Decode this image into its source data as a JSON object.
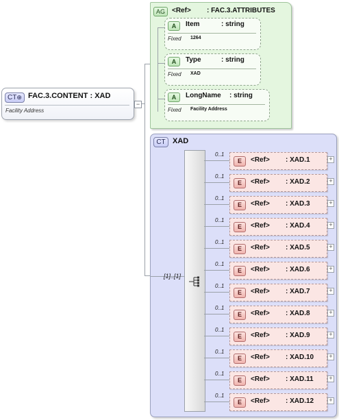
{
  "root": {
    "badge": "CT",
    "name": "FAC.3.CONTENT",
    "type": ": XAD",
    "documentation": "Facility Address"
  },
  "attribute_group": {
    "badge": "AG",
    "ref": "<Ref>",
    "type": ": FAC.3.ATTRIBUTES",
    "attributes": [
      {
        "badge": "A",
        "name": "Item",
        "type": ": string",
        "fixed_label": "Fixed",
        "fixed_value": "1264"
      },
      {
        "badge": "A",
        "name": "Type",
        "type": ": string",
        "fixed_label": "Fixed",
        "fixed_value": "XAD"
      },
      {
        "badge": "A",
        "name": "LongName",
        "type": ": string",
        "fixed_label": "Fixed",
        "fixed_value": "Facility Address"
      }
    ]
  },
  "complex_type": {
    "badge": "CT",
    "name": "XAD",
    "sequence_cardinality": "[1]..[1]",
    "elements": [
      {
        "badge": "E",
        "cardinality": "0..1",
        "ref": "<Ref>",
        "type": ": XAD.1"
      },
      {
        "badge": "E",
        "cardinality": "0..1",
        "ref": "<Ref>",
        "type": ": XAD.2"
      },
      {
        "badge": "E",
        "cardinality": "0..1",
        "ref": "<Ref>",
        "type": ": XAD.3"
      },
      {
        "badge": "E",
        "cardinality": "0..1",
        "ref": "<Ref>",
        "type": ": XAD.4"
      },
      {
        "badge": "E",
        "cardinality": "0..1",
        "ref": "<Ref>",
        "type": ": XAD.5"
      },
      {
        "badge": "E",
        "cardinality": "0..1",
        "ref": "<Ref>",
        "type": ": XAD.6"
      },
      {
        "badge": "E",
        "cardinality": "0..1",
        "ref": "<Ref>",
        "type": ": XAD.7"
      },
      {
        "badge": "E",
        "cardinality": "0..1",
        "ref": "<Ref>",
        "type": ": XAD.8"
      },
      {
        "badge": "E",
        "cardinality": "0..1",
        "ref": "<Ref>",
        "type": ": XAD.9"
      },
      {
        "badge": "E",
        "cardinality": "0..1",
        "ref": "<Ref>",
        "type": ": XAD.10"
      },
      {
        "badge": "E",
        "cardinality": "0..1",
        "ref": "<Ref>",
        "type": ": XAD.11"
      },
      {
        "badge": "E",
        "cardinality": "0..1",
        "ref": "<Ref>",
        "type": ": XAD.12"
      }
    ]
  },
  "icons": {
    "collapse": "minus-icon",
    "expand": "plus-icon",
    "sequence": "sequence-compositor-icon"
  }
}
